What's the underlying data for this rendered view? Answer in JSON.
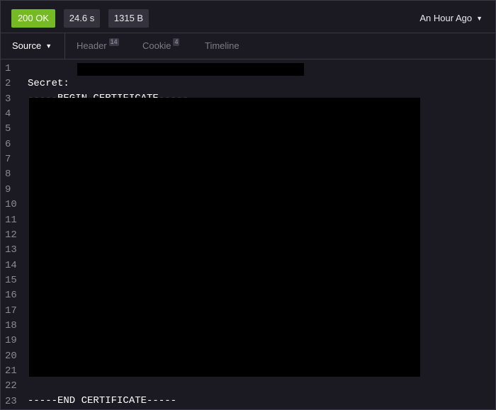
{
  "status_bar": {
    "status": "200 OK",
    "time": "24.6 s",
    "size": "1315 B",
    "history_label": "An Hour Ago"
  },
  "tabs": {
    "source_label": "Source",
    "header_label": "Header",
    "header_count": "14",
    "cookie_label": "Cookie",
    "cookie_count": "4",
    "timeline_label": "Timeline"
  },
  "editor": {
    "line_numbers": [
      "1",
      "2",
      "3",
      "4",
      "5",
      "6",
      "7",
      "8",
      "9",
      "10",
      "11",
      "12",
      "13",
      "14",
      "15",
      "16",
      "17",
      "18",
      "19",
      "20",
      "21",
      "22",
      "23"
    ],
    "line1": "Secret:",
    "line2": "-----BEGIN CERTIFICATE-----",
    "line22": "-----END CERTIFICATE-----"
  },
  "colors": {
    "status_green": "#75ba24",
    "background": "#1b1921",
    "redaction": "#000000"
  }
}
